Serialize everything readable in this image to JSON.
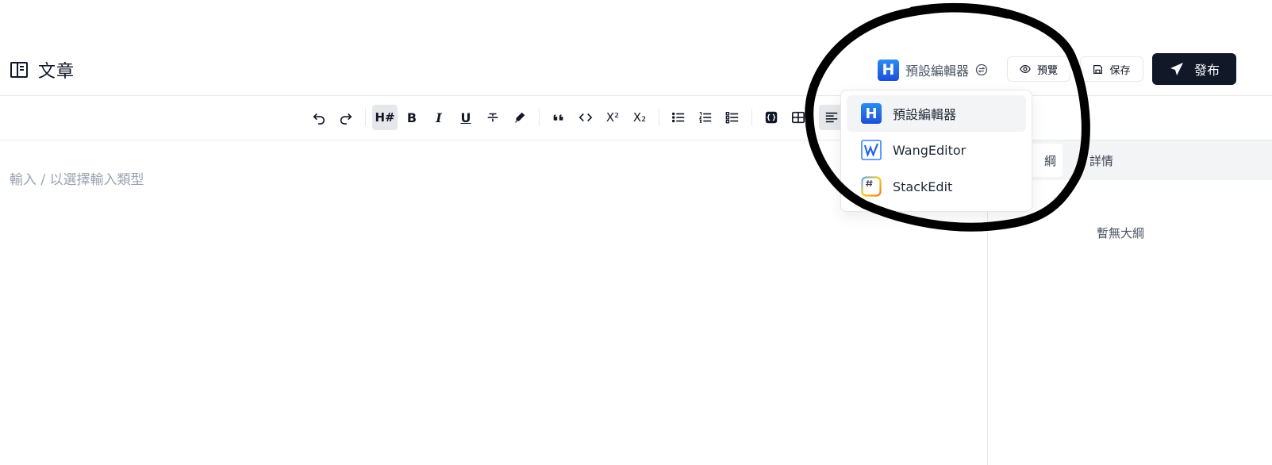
{
  "header": {
    "title": "文章",
    "editor_selector_label": "預設編輯器",
    "preview_label": "預覽",
    "save_label": "保存",
    "publish_label": "發布"
  },
  "editor": {
    "placeholder": "輸入 / 以選擇輸入類型"
  },
  "toolbar": {
    "heading_label": "H#",
    "bold_label": "B",
    "italic_label": "I",
    "underline_label": "U",
    "superscript_label": "X²",
    "subscript_label": "X₂"
  },
  "dropdown": {
    "items": [
      {
        "label": "預設編輯器",
        "icon": "h-logo-icon",
        "selected": true
      },
      {
        "label": "WangEditor",
        "icon": "wangeditor-icon",
        "selected": false
      },
      {
        "label": "StackEdit",
        "icon": "stackedit-icon",
        "selected": false
      }
    ]
  },
  "right_panel": {
    "tab_outline": "綱",
    "tab_details": "詳情",
    "empty_outline": "暫無大綱"
  },
  "logo": {
    "letter": "H"
  },
  "colors": {
    "brand_blue": "#1d6fe0",
    "publish_bg": "#111827",
    "annotation": "#000000"
  }
}
